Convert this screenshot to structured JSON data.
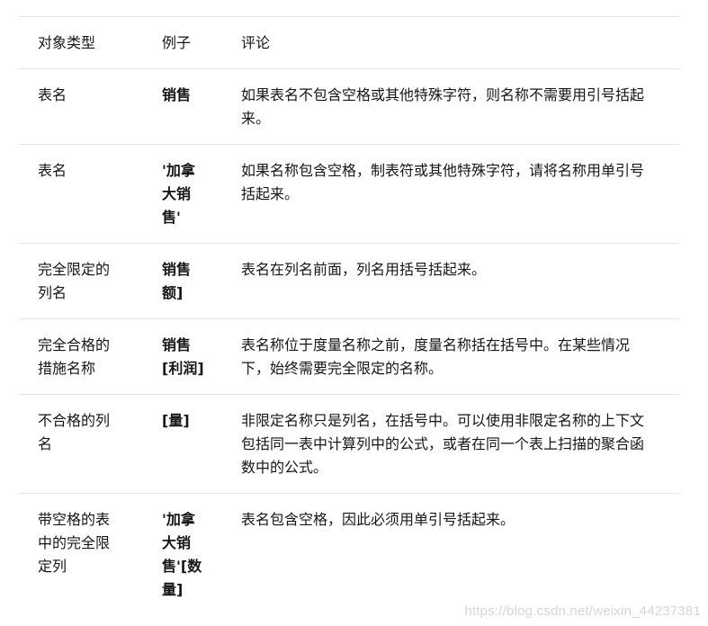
{
  "table": {
    "headers": {
      "type": "对象类型",
      "example": "例子",
      "comment": "评论"
    },
    "rows": [
      {
        "type": "表名",
        "example": "销售",
        "comment": "如果表名不包含空格或其他特殊字符，则名称不需要用引号括起来。"
      },
      {
        "type": "表名",
        "example": "'加拿大销售'",
        "comment": "如果名称包含空格，制表符或其他特殊字符，请将名称用单引号括起来。"
      },
      {
        "type": "完全限定的列名",
        "example": "销售额]",
        "comment": "表名在列名前面，列名用括号括起来。"
      },
      {
        "type": "完全合格的措施名称",
        "example": "销售[利润]",
        "comment": "表名称位于度量名称之前，度量名称括在括号中。在某些情况下，始终需要完全限定的名称。"
      },
      {
        "type": "不合格的列名",
        "example": "[量]",
        "comment": "非限定名称只是列名，在括号中。可以使用非限定名称的上下文包括同一表中计算列中的公式，或者在同一个表上扫描的聚合函数中的公式。"
      },
      {
        "type": "带空格的表中的完全限定列",
        "example": "'加拿大销售'[数量]",
        "comment": "表名包含空格，因此必须用单引号括起来。"
      }
    ]
  },
  "watermark": "https://blog.csdn.net/weixin_44237381"
}
